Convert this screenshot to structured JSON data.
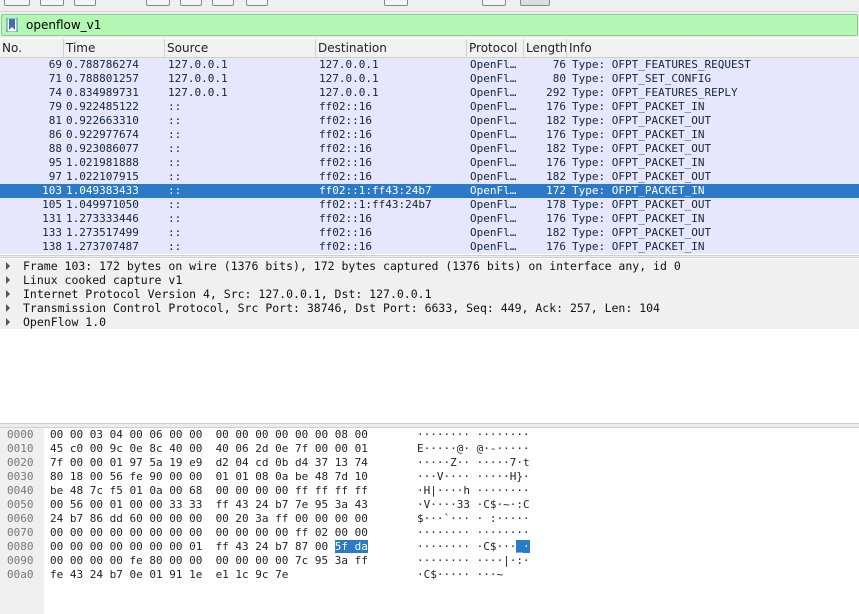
{
  "filter": {
    "value": "openflow_v1",
    "icon": "bookmark-icon"
  },
  "packet_list": {
    "columns": [
      "No.",
      "Time",
      "Source",
      "Destination",
      "Protocol",
      "Length",
      "Info"
    ],
    "rows": [
      {
        "no": "69",
        "time": "0.788786274",
        "src": "127.0.0.1",
        "dst": "127.0.0.1",
        "proto": "OpenFl…",
        "len": "76",
        "info": "Type: OFPT_FEATURES_REQUEST"
      },
      {
        "no": "71",
        "time": "0.788801257",
        "src": "127.0.0.1",
        "dst": "127.0.0.1",
        "proto": "OpenFl…",
        "len": "80",
        "info": "Type: OFPT_SET_CONFIG"
      },
      {
        "no": "74",
        "time": "0.834989731",
        "src": "127.0.0.1",
        "dst": "127.0.0.1",
        "proto": "OpenFl…",
        "len": "292",
        "info": "Type: OFPT_FEATURES_REPLY"
      },
      {
        "no": "79",
        "time": "0.922485122",
        "src": "::",
        "dst": "ff02::16",
        "proto": "OpenFl…",
        "len": "176",
        "info": "Type: OFPT_PACKET_IN"
      },
      {
        "no": "81",
        "time": "0.922663310",
        "src": "::",
        "dst": "ff02::16",
        "proto": "OpenFl…",
        "len": "182",
        "info": "Type: OFPT_PACKET_OUT"
      },
      {
        "no": "86",
        "time": "0.922977674",
        "src": "::",
        "dst": "ff02::16",
        "proto": "OpenFl…",
        "len": "176",
        "info": "Type: OFPT_PACKET_IN"
      },
      {
        "no": "88",
        "time": "0.923086077",
        "src": "::",
        "dst": "ff02::16",
        "proto": "OpenFl…",
        "len": "182",
        "info": "Type: OFPT_PACKET_OUT"
      },
      {
        "no": "95",
        "time": "1.021981888",
        "src": "::",
        "dst": "ff02::16",
        "proto": "OpenFl…",
        "len": "176",
        "info": "Type: OFPT_PACKET_IN"
      },
      {
        "no": "97",
        "time": "1.022107915",
        "src": "::",
        "dst": "ff02::16",
        "proto": "OpenFl…",
        "len": "182",
        "info": "Type: OFPT_PACKET_OUT"
      },
      {
        "no": "103",
        "time": "1.049383433",
        "src": "::",
        "dst": "ff02::1:ff43:24b7",
        "proto": "OpenFl…",
        "len": "172",
        "info": "Type: OFPT_PACKET_IN",
        "selected": true
      },
      {
        "no": "105",
        "time": "1.049971050",
        "src": "::",
        "dst": "ff02::1:ff43:24b7",
        "proto": "OpenFl…",
        "len": "178",
        "info": "Type: OFPT_PACKET_OUT"
      },
      {
        "no": "131",
        "time": "1.273333446",
        "src": "::",
        "dst": "ff02::16",
        "proto": "OpenFl…",
        "len": "176",
        "info": "Type: OFPT_PACKET_IN"
      },
      {
        "no": "133",
        "time": "1.273517499",
        "src": "::",
        "dst": "ff02::16",
        "proto": "OpenFl…",
        "len": "182",
        "info": "Type: OFPT_PACKET_OUT"
      },
      {
        "no": "138",
        "time": "1.273707487",
        "src": "::",
        "dst": "ff02::16",
        "proto": "OpenFl…",
        "len": "176",
        "info": "Type: OFPT_PACKET_IN"
      }
    ]
  },
  "details": [
    "Frame 103: 172 bytes on wire (1376 bits), 172 bytes captured (1376 bits) on interface any, id 0",
    "Linux cooked capture v1",
    "Internet Protocol Version 4, Src: 127.0.0.1, Dst: 127.0.0.1",
    "Transmission Control Protocol, Src Port: 38746, Dst Port: 6633, Seq: 449, Ack: 257, Len: 104",
    "OpenFlow 1.0"
  ],
  "bytes": [
    {
      "offset": "0000",
      "hex": "00 00 03 04 00 06 00 00  00 00 00 00 00 00 08 00",
      "ascii": "········ ········"
    },
    {
      "offset": "0010",
      "hex": "45 c0 00 9c 0e 8c 40 00  40 06 2d 0e 7f 00 00 01",
      "ascii": "E·····@· @·-·····"
    },
    {
      "offset": "0020",
      "hex": "7f 00 00 01 97 5a 19 e9  d2 04 cd 0b d4 37 13 74",
      "ascii": "·····Z·· ·····7·t"
    },
    {
      "offset": "0030",
      "hex": "80 18 00 56 fe 90 00 00  01 01 08 0a be 48 7d 10",
      "ascii": "···V···· ·····H}·"
    },
    {
      "offset": "0040",
      "hex": "be 48 7c f5 01 0a 00 68  00 00 00 00 ff ff ff ff",
      "ascii": "·H|····h ········"
    },
    {
      "offset": "0050",
      "hex": "00 56 00 01 00 00 33 33  ff 43 24 b7 7e 95 3a 43",
      "ascii": "·V····33 ·C$·~·:C"
    },
    {
      "offset": "0060",
      "hex": "24 b7 86 dd 60 00 00 00  00 20 3a ff 00 00 00 00",
      "ascii": "$···`··· · :·····"
    },
    {
      "offset": "0070",
      "hex": "00 00 00 00 00 00 00 00  00 00 00 00 ff 02 00 00",
      "ascii": "········ ········"
    },
    {
      "offset": "0080",
      "hex": "00 00 00 00 00 00 00 01  ff 43 24 b7 87 00 ",
      "hex_hl": "5f da",
      "ascii": "········ ·C$···",
      "ascii_hl": "_·"
    },
    {
      "offset": "0090",
      "hex": "00 00 00 00 fe 80 00 00  00 00 00 00 7c 95 3a ff",
      "ascii": "········ ····|·:·"
    },
    {
      "offset": "00a0",
      "hex": "fe 43 24 b7 0e 01 91 1e  e1 1c 9c 7e",
      "ascii": "·C$····· ···~"
    }
  ]
}
